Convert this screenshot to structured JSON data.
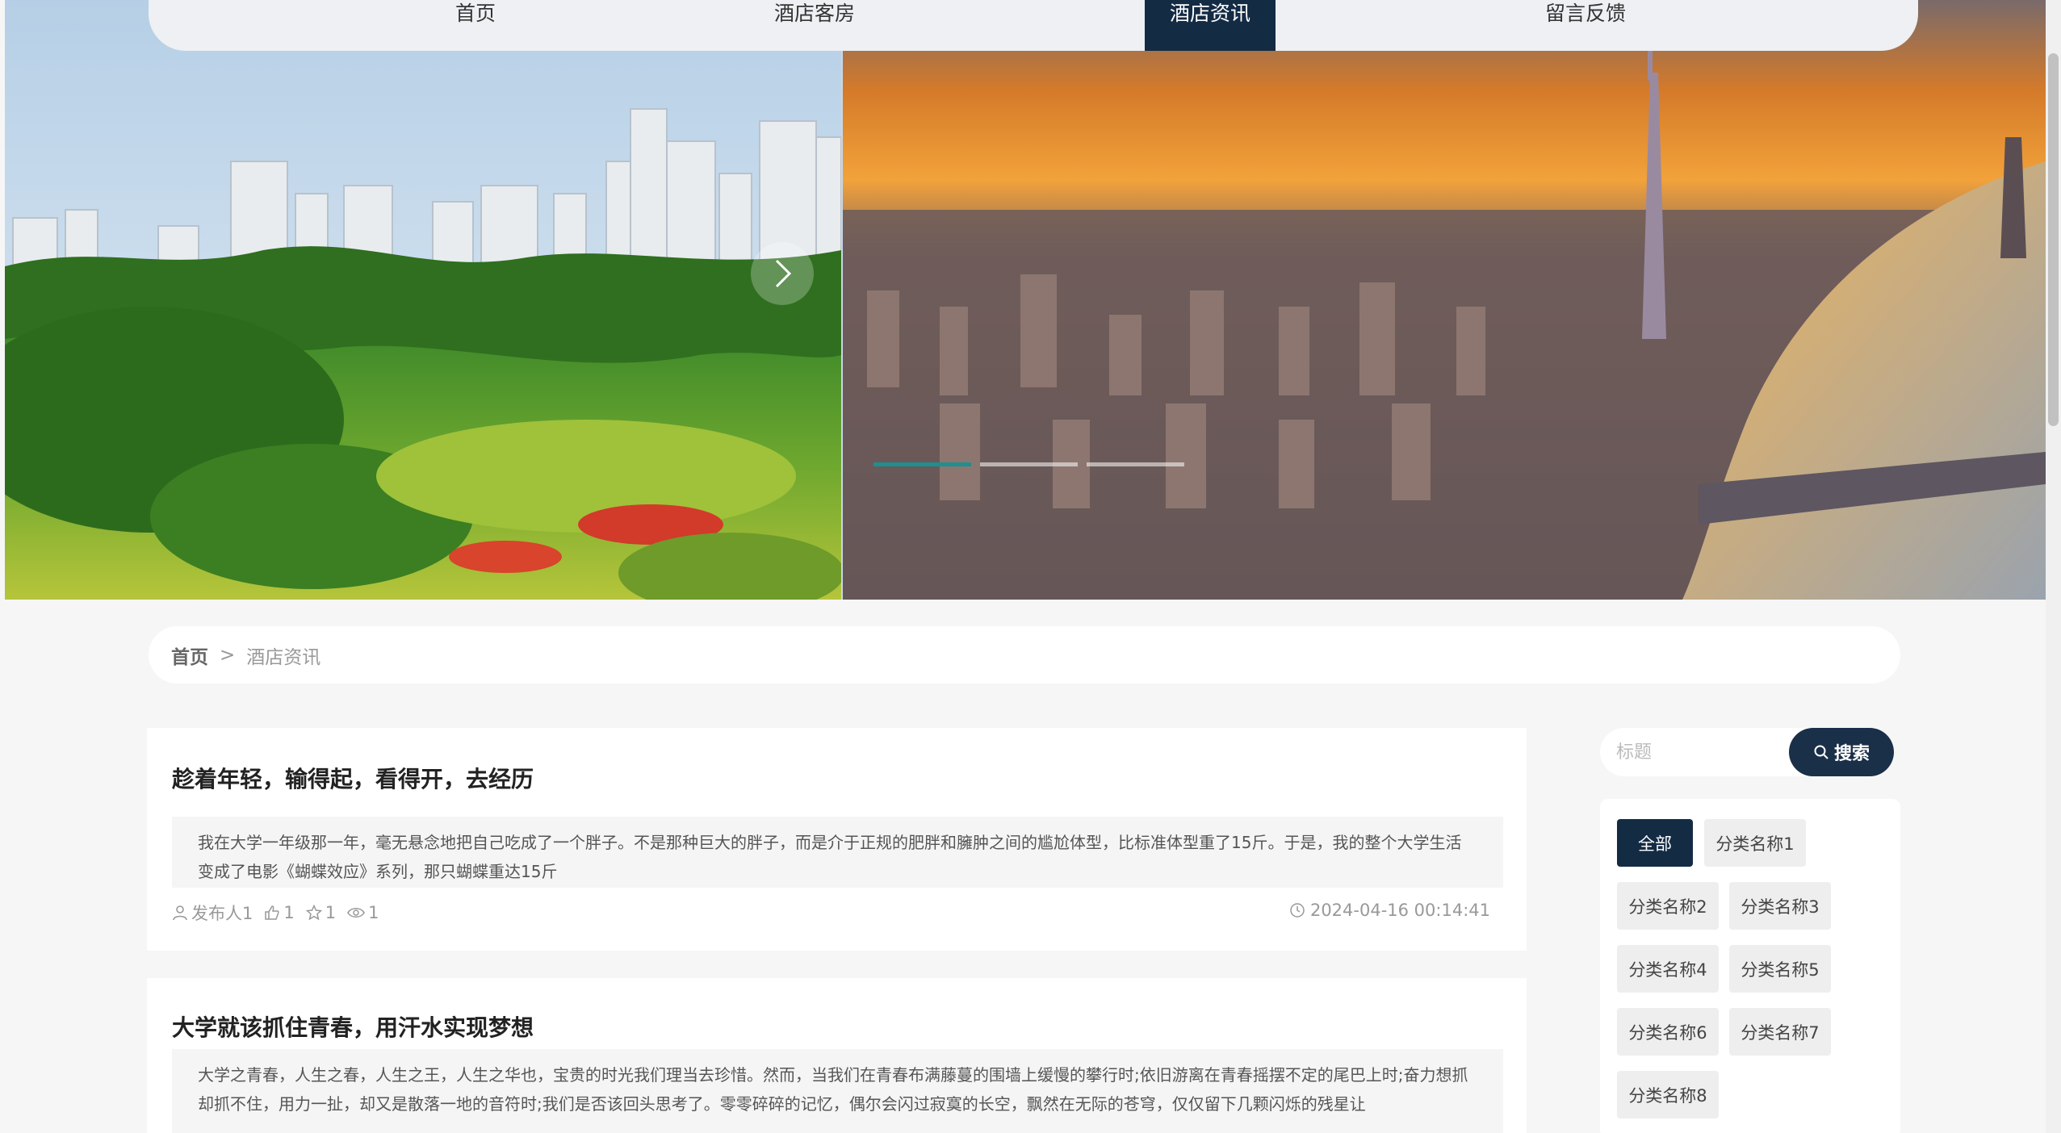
{
  "nav": {
    "items": [
      {
        "label": "首页"
      },
      {
        "label": "酒店客房"
      },
      {
        "label": "酒店资讯"
      },
      {
        "label": "留言反馈"
      }
    ],
    "active_index": 2
  },
  "banner": {
    "slide_count": 3,
    "active_slide": 0
  },
  "breadcrumb": {
    "home": "首页",
    "separator": ">",
    "current": "酒店资讯"
  },
  "articles": [
    {
      "title": "趁着年轻，输得起，看得开，去经历",
      "summary": "我在大学一年级那一年，毫无悬念地把自己吃成了一个胖子。不是那种巨大的胖子，而是介于正规的肥胖和臃肿之间的尴尬体型，比标准体型重了15斤。于是，我的整个大学生活变成了电影《蝴蝶效应》系列，那只蝴蝶重达15斤",
      "author": "发布人1",
      "likes": "1",
      "favorites": "1",
      "views": "1",
      "date": "2024-04-16 00:14:41"
    },
    {
      "title": "大学就该抓住青春，用汗水实现梦想",
      "summary": "大学之青春，人生之春，人生之王，人生之华也，宝贵的时光我们理当去珍惜。然而，当我们在青春布满藤蔓的围墙上缓慢的攀行时;依旧游离在青春摇摆不定的尾巴上时;奋力想抓却抓不住，用力一扯，却又是散落一地的音符时;我们是否该回头思考了。零零碎碎的记忆，偶尔会闪过寂寞的长空，飘然在无际的苍穹，仅仅留下几颗闪烁的残星让"
    }
  ],
  "search": {
    "placeholder": "标题",
    "button_label": "搜索"
  },
  "categories": [
    "全部",
    "分类名称1",
    "分类名称2",
    "分类名称3",
    "分类名称4",
    "分类名称5",
    "分类名称6",
    "分类名称7",
    "分类名称8"
  ],
  "colors": {
    "primary": "#142b44",
    "dot_active": "#1f8f8f"
  }
}
